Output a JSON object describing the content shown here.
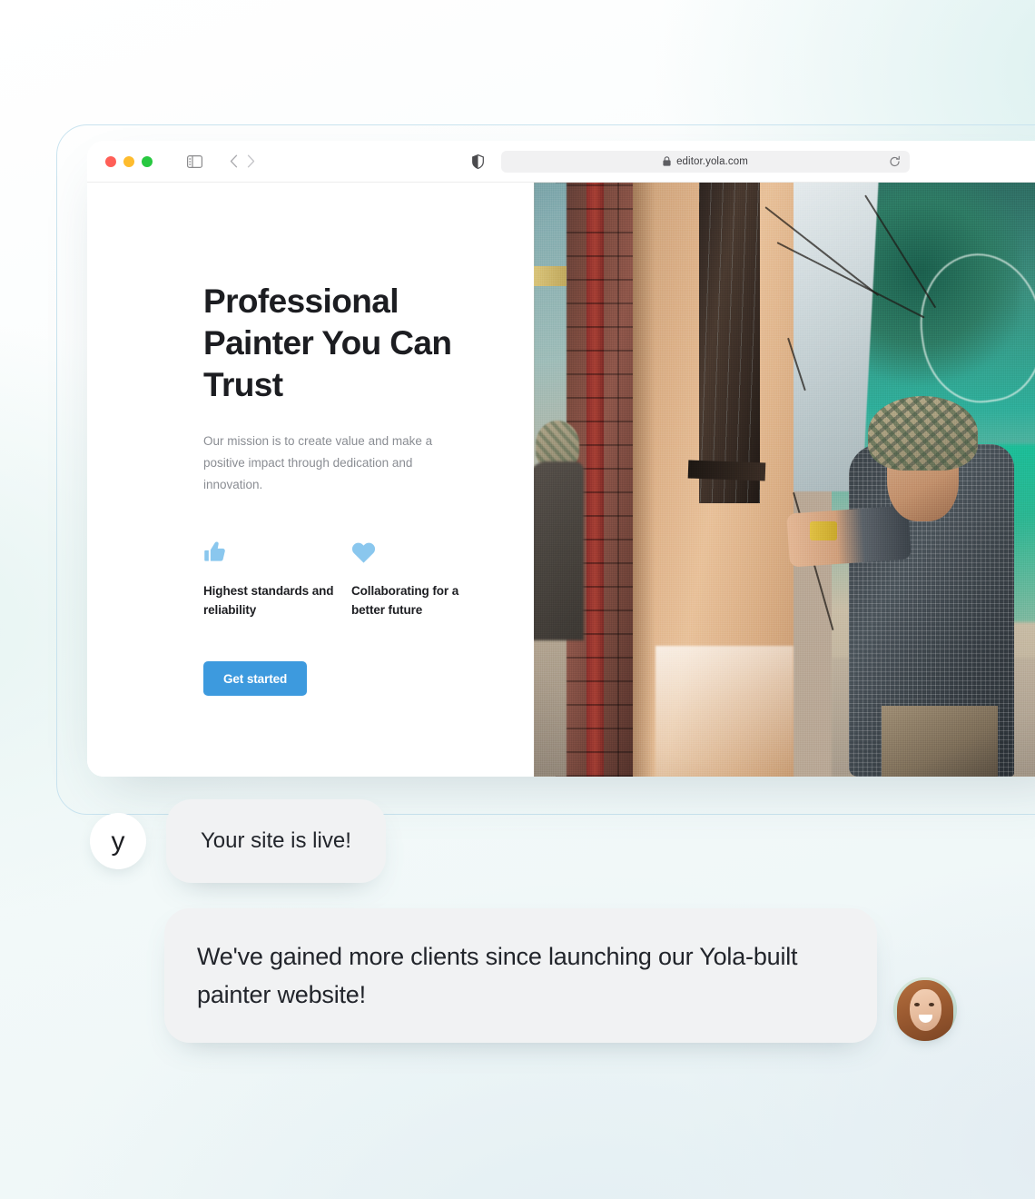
{
  "browser": {
    "traffic_lights": [
      "close",
      "minimize",
      "maximize"
    ],
    "url": "editor.yola.com",
    "lock_icon": "lock-icon",
    "sidebar_icon": "sidebar-toggle-icon",
    "back_icon": "chevron-left-icon",
    "forward_icon": "chevron-right-icon",
    "shield_icon": "privacy-shield-icon",
    "reload_icon": "reload-icon"
  },
  "site": {
    "headline": "Professional Painter You Can Trust",
    "subheadline": "Our mission is to create value and make a positive impact through dedication and innovation.",
    "features": [
      {
        "icon": "thumbs-up-icon",
        "label": "Highest standards and reliability"
      },
      {
        "icon": "heart-icon",
        "label": "Collaborating for a better future"
      }
    ],
    "cta_label": "Get started",
    "hero_image_alt": "Painter in camouflage bucket hat applying plaster to an exterior wall"
  },
  "chat": {
    "brand_mark": "y",
    "messages": [
      {
        "sender": "yola",
        "text": "Your site is live!"
      },
      {
        "sender": "customer",
        "text": "We've gained more clients since launching our Yola-built painter website!"
      }
    ],
    "customer_avatar_alt": "Smiling woman with long auburn hair"
  },
  "colors": {
    "accent_blue": "#3d9ade",
    "feature_icon_blue": "#8ac7ee",
    "bubble_gray": "#f1f2f3",
    "heading_dark": "#1c1d21",
    "body_gray": "#8a8d93",
    "frame_outline": "#c9e3ef"
  }
}
